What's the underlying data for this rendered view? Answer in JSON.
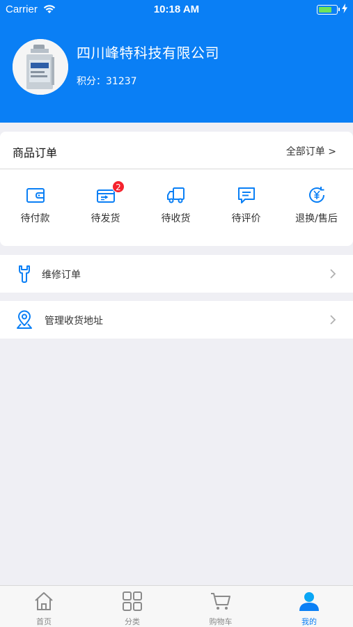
{
  "status_bar": {
    "carrier": "Carrier",
    "time": "10:18 AM"
  },
  "profile": {
    "company_name": "四川峰特科技有限公司",
    "points_label": "积分：31237"
  },
  "orders": {
    "title": "商品订单",
    "all_link": "全部订单 >",
    "items": [
      {
        "label": "待付款",
        "icon": "wallet-icon"
      },
      {
        "label": "待发货",
        "icon": "shipping-box-icon",
        "badge": "2"
      },
      {
        "label": "待收货",
        "icon": "truck-icon"
      },
      {
        "label": "待评价",
        "icon": "comment-icon"
      },
      {
        "label": "退换/售后",
        "icon": "refund-yen-icon"
      }
    ]
  },
  "rows": {
    "repair": {
      "label": "维修订单",
      "icon": "wrench-icon"
    },
    "address": {
      "label": "管理收货地址",
      "icon": "location-icon"
    }
  },
  "tabbar": {
    "tabs": [
      {
        "label": "首页",
        "icon": "home-icon"
      },
      {
        "label": "分类",
        "icon": "grid-icon"
      },
      {
        "label": "购物车",
        "icon": "cart-icon"
      },
      {
        "label": "我的",
        "icon": "user-icon",
        "active": true
      }
    ]
  },
  "colors": {
    "brand": "#0a7ff5",
    "badge": "#f5222d",
    "background": "#efeff4"
  }
}
